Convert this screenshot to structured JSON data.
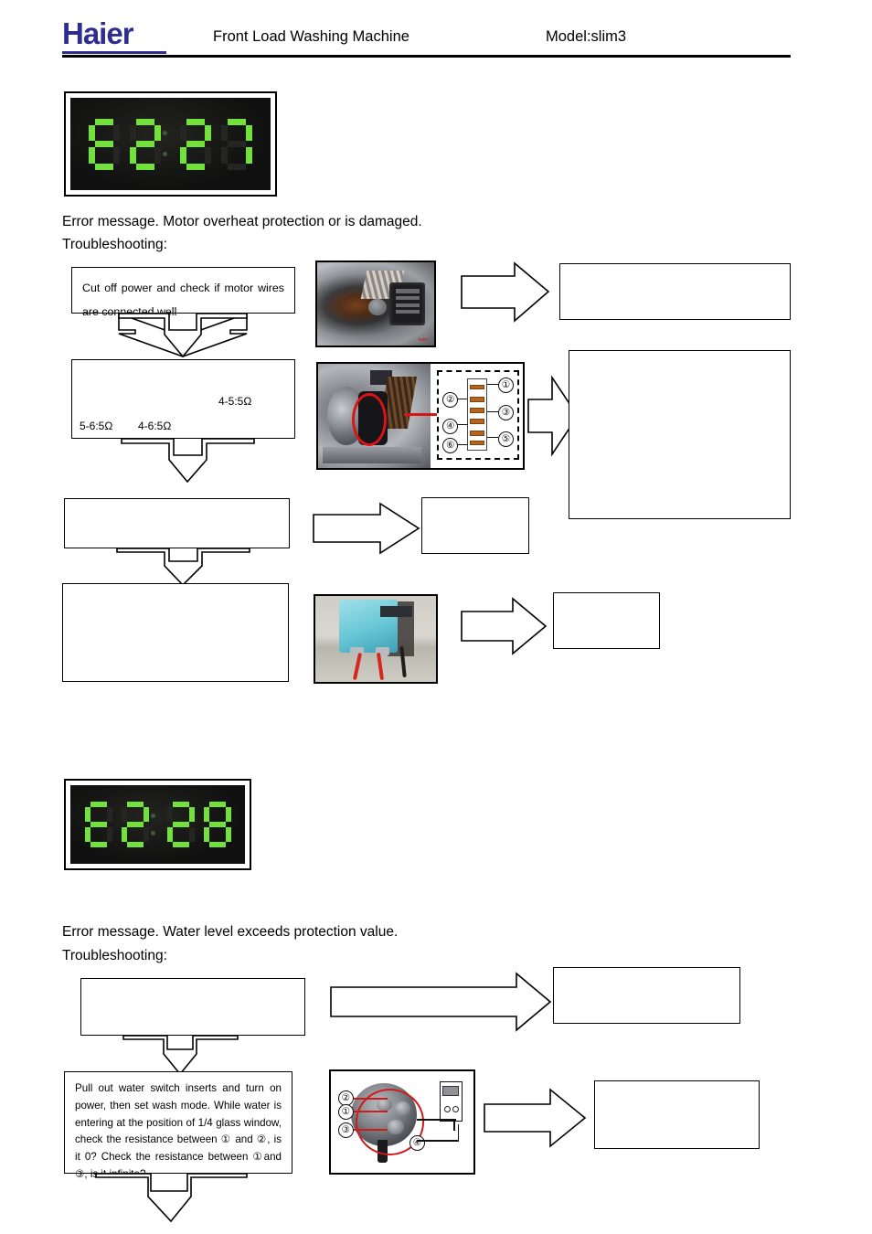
{
  "header": {
    "logo_text": "Haier",
    "title": "Front Load Washing Machine",
    "model": "Model:slim3"
  },
  "sections": [
    {
      "id": "motor-overheat",
      "display": {
        "label": "error-code-display",
        "digits": [
          "E",
          "2",
          "2",
          "7"
        ],
        "colon": ":",
        "lit_color": "#72e13a",
        "off_color": "#252523",
        "background": "#141414"
      },
      "error_message": "Error message. Motor overheat protection or is damaged.",
      "troubleshooting_label": "Troubleshooting:",
      "boxes": {
        "step1": "Cut off power and check if motor wires are connected well",
        "step2": "",
        "step3": "",
        "step4": "",
        "result1": "",
        "result2": "",
        "result3": "",
        "result4": ""
      },
      "resistances": {
        "r45": "4-5:5Ω",
        "r56": "5-6:5Ω",
        "r46": "4-6:5Ω"
      },
      "terminal_numbers": [
        "①",
        "②",
        "③",
        "④",
        "⑤",
        "⑥"
      ]
    },
    {
      "id": "water-level",
      "display": {
        "label": "error-code-display",
        "digits": [
          "E",
          "2",
          "2",
          "8"
        ],
        "colon": ":",
        "lit_color": "#72e13a",
        "off_color": "#252523",
        "background": "#141414"
      },
      "error_message": "Error message. Water level exceeds protection value.",
      "troubleshooting_label": "Troubleshooting:",
      "boxes": {
        "step1": "",
        "step2": "Pull out water switch inserts and turn on power, then set wash mode. While water is entering at the position of 1/4 glass window, check the resistance between ① and ②, is it 0? Check the resistance between ①and ③, is it infinite?",
        "result1": "",
        "result2": ""
      },
      "pressure_switch_numbers": [
        "①",
        "②",
        "③",
        "④"
      ]
    }
  ]
}
